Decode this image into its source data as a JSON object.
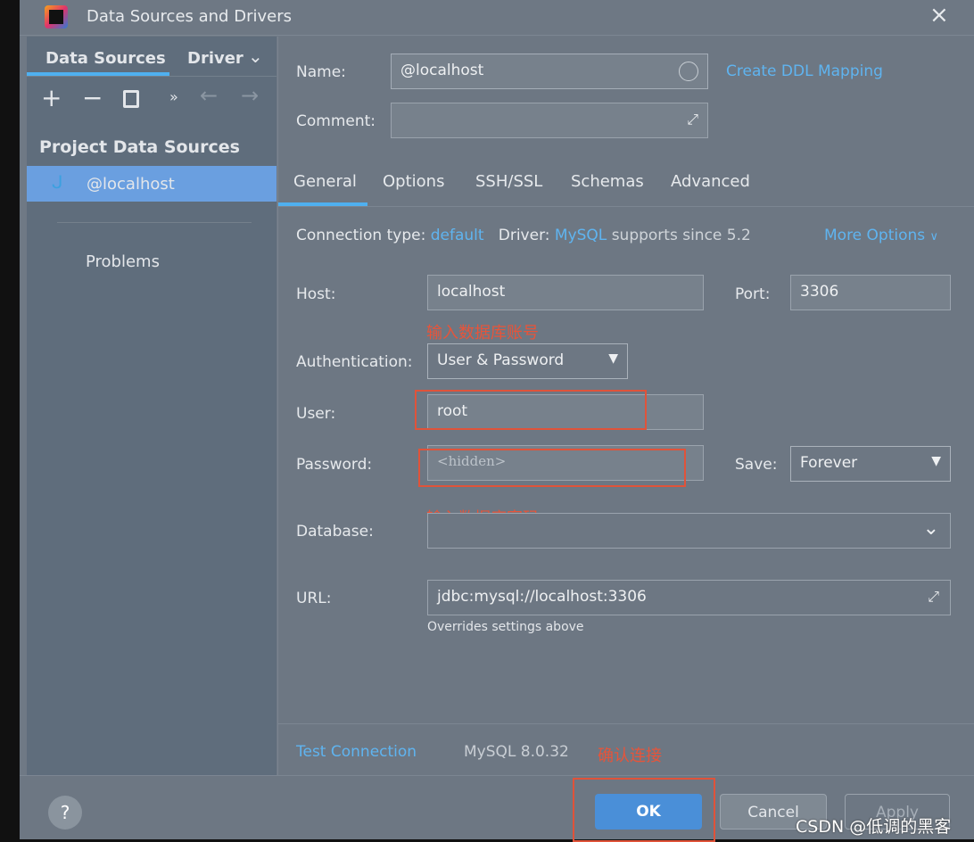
{
  "window": {
    "title": "Data Sources and Drivers",
    "close": "×"
  },
  "sidebar": {
    "tabs": [
      {
        "label": "Data Sources",
        "active": true
      },
      {
        "label": "Driver"
      }
    ],
    "toolbar": {
      "add": "+",
      "remove": "−",
      "more": "»",
      "back": "←",
      "forward": "→"
    },
    "section": "Project Data Sources",
    "items": [
      {
        "label": "@localhost",
        "selected": true
      }
    ],
    "problems": "Problems"
  },
  "form": {
    "name_label": "Name:",
    "name_value": "@localhost",
    "ddl_link": "Create DDL Mapping",
    "comment_label": "Comment:",
    "comment_value": ""
  },
  "tabs": [
    "General",
    "Options",
    "SSH/SSL",
    "Schemas",
    "Advanced"
  ],
  "general": {
    "conn_type_label": "Connection type:",
    "conn_type": "default",
    "driver_label": "Driver:",
    "driver": "MySQL",
    "driver_note": "supports since 5.2",
    "more_options": "More Options",
    "host_label": "Host:",
    "host": "localhost",
    "port_label": "Port:",
    "port": "3306",
    "auth_label": "Authentication:",
    "auth": "User & Password",
    "user_label": "User:",
    "user": "root",
    "password_label": "Password:",
    "password_placeholder": "<hidden>",
    "save_label": "Save:",
    "save": "Forever",
    "database_label": "Database:",
    "database": "",
    "url_label": "URL:",
    "url": "jdbc:mysql://localhost:3306",
    "url_hint": "Overrides settings above"
  },
  "annotations": {
    "user_note": "输入数据库账号",
    "password_note": "输入数据库密码",
    "ok_note": "确认连接"
  },
  "bottom": {
    "test_connection": "Test Connection",
    "version": "MySQL 8.0.32"
  },
  "footer": {
    "help": "?",
    "ok": "OK",
    "cancel": "Cancel",
    "apply": "Apply"
  },
  "watermark": "CSDN @低调的黑客",
  "colors": {
    "accent": "#5fb4f0",
    "selection": "#6a9fe0",
    "ok_button": "#4a8fd8",
    "annotation": "#e0533a"
  }
}
